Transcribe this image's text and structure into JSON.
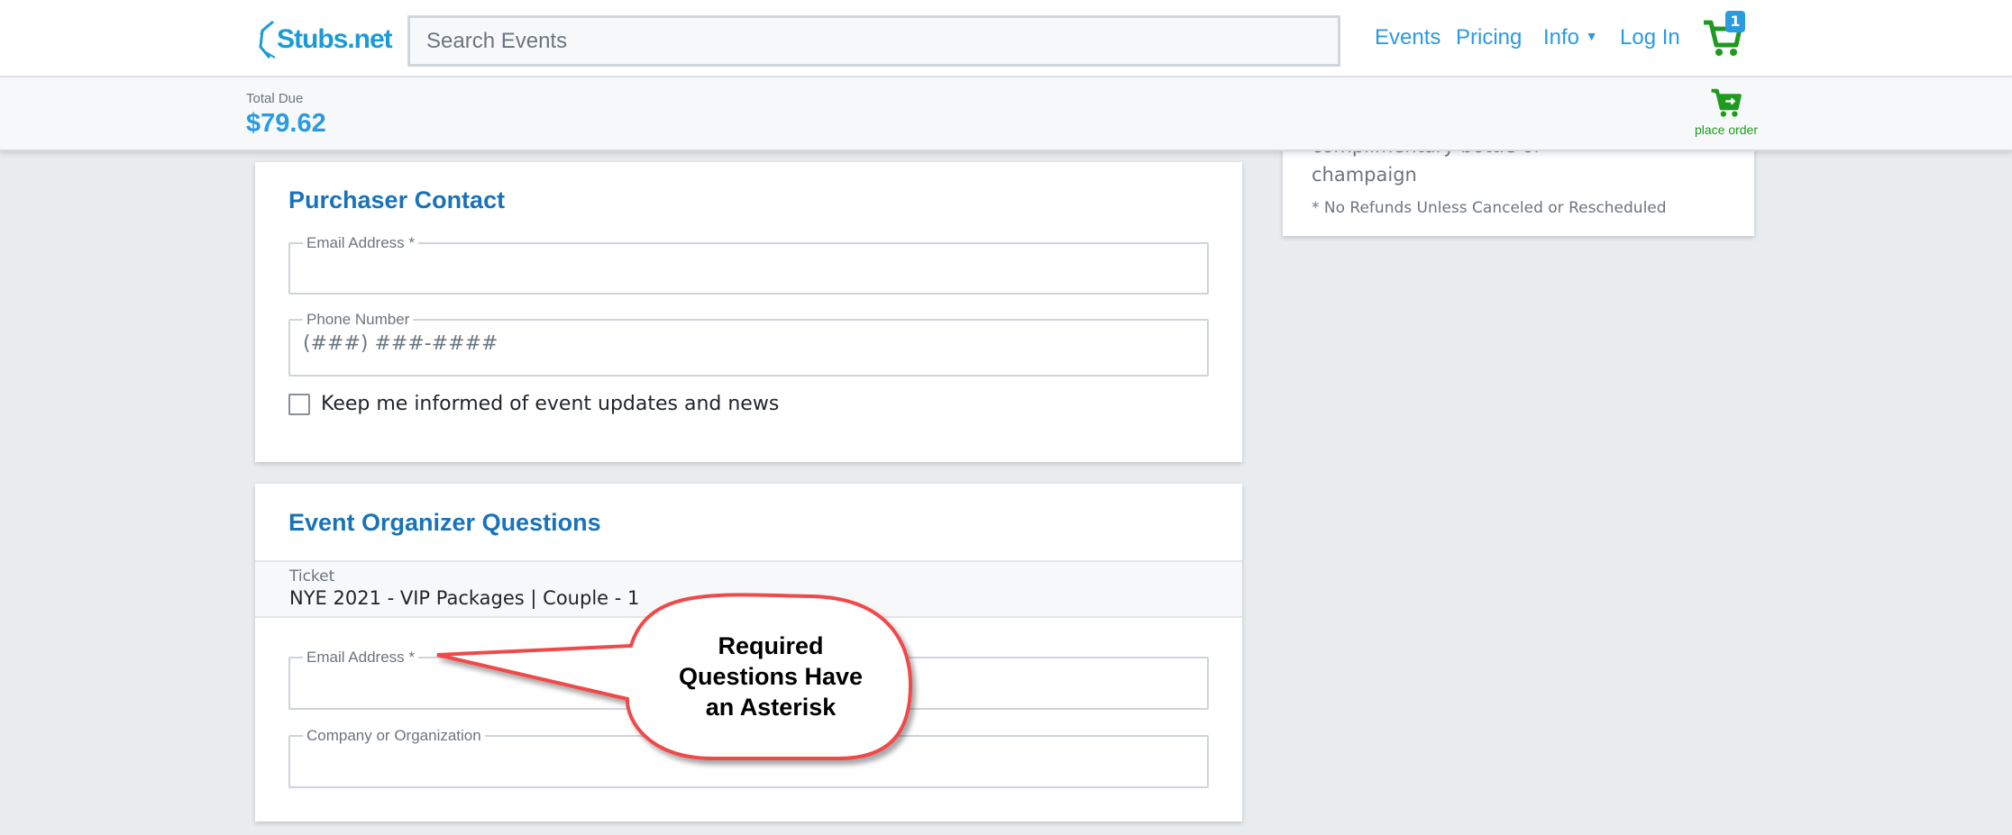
{
  "header": {
    "logo": "Stubs.net",
    "search_placeholder": "Search Events",
    "nav": [
      "Events",
      "Pricing",
      "Info",
      "Log In"
    ],
    "cart_count": "1"
  },
  "subbar": {
    "total_label": "Total Due",
    "total_value": "$79.62",
    "place_order": "place order"
  },
  "sidebar_card": {
    "line1": "complimentary bottle of",
    "line2": "champaign",
    "note": "* No Refunds Unless Canceled or Rescheduled"
  },
  "purchaser": {
    "title": "Purchaser Contact",
    "email_label": "Email Address *",
    "phone_label": "Phone Number",
    "phone_placeholder": "(###) ###-####",
    "checkbox_label": "Keep me informed of event updates and news",
    "checkbox_checked": false
  },
  "questions": {
    "title": "Event Organizer Questions",
    "ticket_label": "Ticket",
    "ticket_value": "NYE 2021 - VIP Packages | Couple - 1",
    "email_label": "Email Address *",
    "company_label": "Company or Organization"
  },
  "callout": {
    "lines": [
      "Required",
      "Questions Have",
      "an Asterisk"
    ],
    "border_color": "#f04848"
  },
  "colors": {
    "brand": "#1a9bd7",
    "link": "#2a9be0",
    "cart": "#1e9a1e",
    "title": "#1a73b8"
  }
}
